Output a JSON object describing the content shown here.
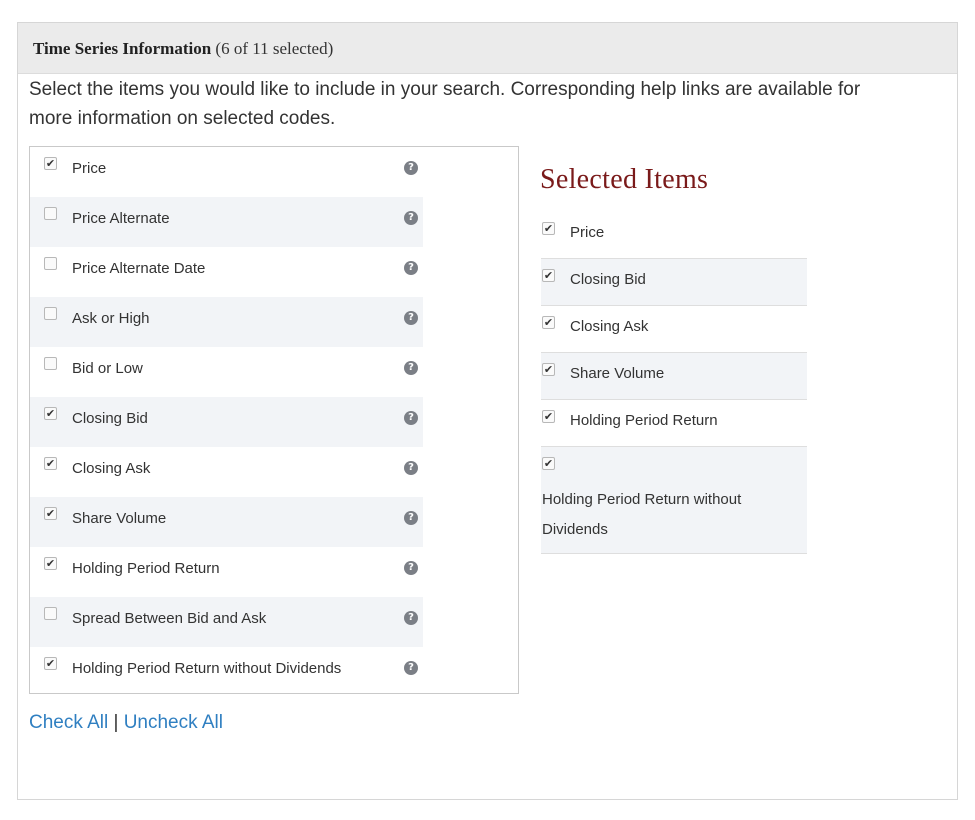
{
  "panel": {
    "title": "Time Series Information",
    "count": "(6 of 11 selected)"
  },
  "instructions": "Select the items you would like to include in your search. Corresponding help links are available for more information on selected codes.",
  "options": [
    {
      "label": "Price",
      "checked": true
    },
    {
      "label": "Price Alternate",
      "checked": false
    },
    {
      "label": "Price Alternate Date",
      "checked": false
    },
    {
      "label": "Ask or High",
      "checked": false
    },
    {
      "label": "Bid or Low",
      "checked": false
    },
    {
      "label": "Closing Bid",
      "checked": true
    },
    {
      "label": "Closing Ask",
      "checked": true
    },
    {
      "label": "Share Volume",
      "checked": true
    },
    {
      "label": "Holding Period Return",
      "checked": true
    },
    {
      "label": "Spread Between Bid and Ask",
      "checked": false
    },
    {
      "label": "Holding Period Return without Dividends",
      "checked": true
    }
  ],
  "help_glyph": "?",
  "check_glyph": "✔",
  "links": {
    "check_all": "Check All",
    "separator": "|",
    "uncheck_all": "Uncheck All"
  },
  "selected": {
    "title": "Selected Items",
    "items": [
      "Price",
      "Closing Bid",
      "Closing Ask",
      "Share Volume",
      "Holding Period Return",
      "Holding Period Return without Dividends"
    ]
  },
  "colors": {
    "link": "#2f7fc1",
    "selected_title": "#7a1a1a",
    "header_bg": "#ebebeb",
    "row_alt_bg": "#f2f4f7"
  }
}
